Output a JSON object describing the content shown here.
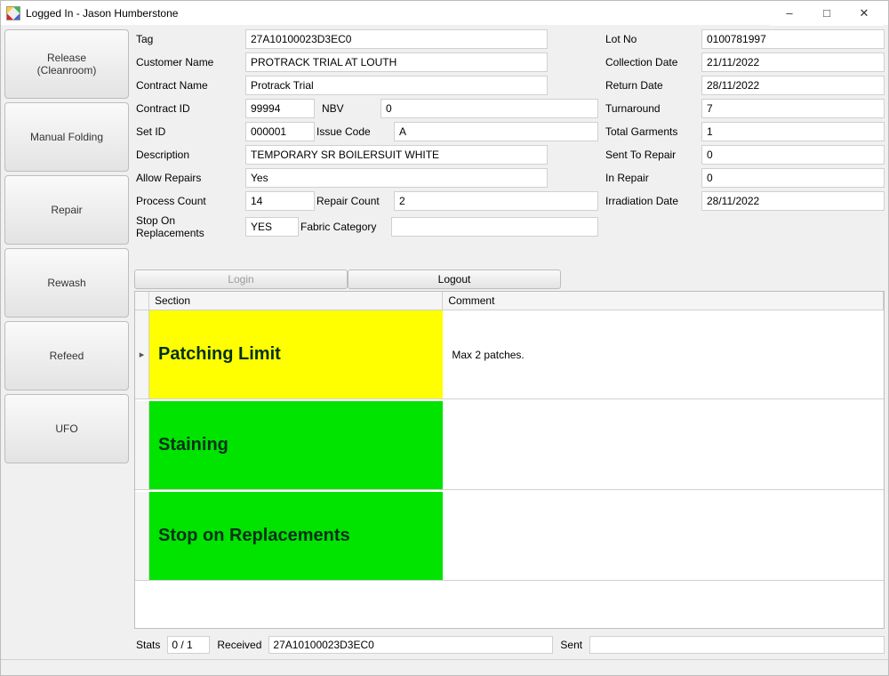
{
  "window": {
    "title": "Logged In - Jason Humberstone"
  },
  "sidebar": {
    "buttons": [
      "Release\n(Cleanroom)",
      "Manual Folding",
      "Repair",
      "Rewash",
      "Refeed",
      "UFO"
    ]
  },
  "form_left": {
    "tag_label": "Tag",
    "tag_value": "27A10100023D3EC0",
    "customer_label": "Customer Name",
    "customer_value": "PROTRACK TRIAL AT LOUTH",
    "contract_label": "Contract Name",
    "contract_value": "Protrack Trial",
    "contract_id_label": "Contract ID",
    "contract_id_value": "99994",
    "nbv_label": "NBV",
    "nbv_value": "0",
    "set_id_label": "Set ID",
    "set_id_value": "000001",
    "issue_code_label": "Issue Code",
    "issue_code_value": "A",
    "description_label": "Description",
    "description_value": "TEMPORARY SR BOILERSUIT WHITE",
    "allow_repairs_label": "Allow Repairs",
    "allow_repairs_value": "Yes",
    "process_count_label": "Process Count",
    "process_count_value": "14",
    "repair_count_label": "Repair Count",
    "repair_count_value": "2",
    "stop_on_repl_label": "Stop On Replacements",
    "stop_on_repl_value": "YES",
    "fabric_cat_label": "Fabric Category",
    "fabric_cat_value": ""
  },
  "form_right": {
    "lot_no_label": "Lot No",
    "lot_no_value": "0100781997",
    "collection_label": "Collection Date",
    "collection_value": "21/11/2022",
    "return_label": "Return Date",
    "return_value": "28/11/2022",
    "turnaround_label": "Turnaround",
    "turnaround_value": "7",
    "total_garments_label": "Total Garments",
    "total_garments_value": "1",
    "sent_repair_label": "Sent To Repair",
    "sent_repair_value": "0",
    "in_repair_label": "In Repair",
    "in_repair_value": "0",
    "irradiation_label": "Irradiation Date",
    "irradiation_value": "28/11/2022"
  },
  "auth": {
    "login": "Login",
    "logout": "Logout"
  },
  "grid": {
    "head_section": "Section",
    "head_comment": "Comment",
    "rows": [
      {
        "section": "Patching Limit",
        "comment": "Max 2 patches.",
        "color": "#ffff00",
        "current": true
      },
      {
        "section": "Staining",
        "comment": "",
        "color": "#00e400",
        "current": false
      },
      {
        "section": "Stop on Replacements",
        "comment": "",
        "color": "#00e400",
        "current": false
      }
    ]
  },
  "status": {
    "stats_label": "Stats",
    "stats_value": "0 / 1",
    "received_label": "Received",
    "received_value": "27A10100023D3EC0",
    "sent_label": "Sent",
    "sent_value": ""
  }
}
